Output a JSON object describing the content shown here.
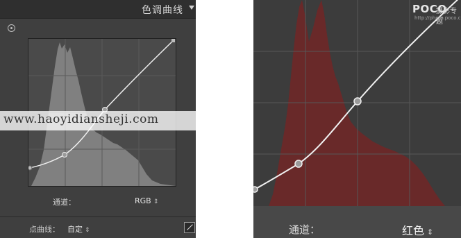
{
  "left_panel": {
    "title": "色调曲线",
    "channel_label": "通道：",
    "channel_value": "RGB",
    "point_curve_label": "点曲线：",
    "point_curve_value": "自定",
    "dropdown_glyph": "⇕"
  },
  "watermark": {
    "text": "www.haoyidiansheji.com"
  },
  "right_panel": {
    "logo": "POCO",
    "logo_sub": "摄影专题",
    "logo_url": "http://photo.poco.cn/",
    "channel_label": "通道：",
    "channel_value": "红色",
    "dropdown_glyph": "⇕"
  },
  "colors": {
    "panel_bg": "#3f3f3f",
    "histogram_gray": "#8a8a8a",
    "histogram_red": "#6b2828",
    "curve": "#f0f0f0"
  }
}
